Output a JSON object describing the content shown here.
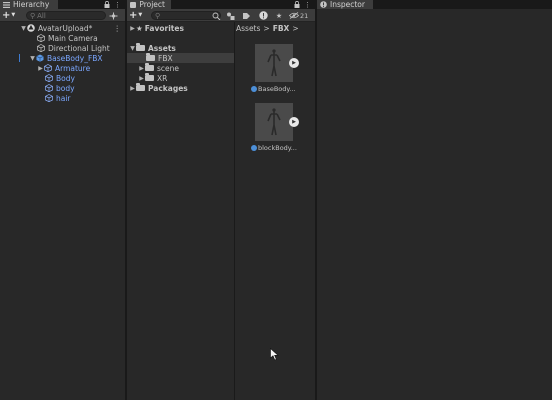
{
  "hierarchy": {
    "tab_label": "Hierarchy",
    "search_placeholder": "All",
    "scene_name": "AvatarUpload*",
    "items": [
      {
        "label": "Main Camera"
      },
      {
        "label": "Directional Light"
      },
      {
        "label": "BaseBody_FBX"
      },
      {
        "label": "Armature"
      },
      {
        "label": "Body"
      },
      {
        "label": "body"
      },
      {
        "label": "hair"
      }
    ]
  },
  "project": {
    "tab_label": "Project",
    "hidden_count": "21",
    "tree": {
      "favorites": "Favorites",
      "assets": "Assets",
      "fbx": "FBX",
      "scene": "scene",
      "xr": "XR",
      "packages": "Packages"
    },
    "breadcrumb": {
      "root": "Assets",
      "sep": ">",
      "current": "FBX",
      "end": ">"
    },
    "assets": [
      {
        "label": "BaseBody..."
      },
      {
        "label": "blockBody..."
      }
    ]
  },
  "inspector": {
    "tab_label": "Inspector"
  },
  "colors": {
    "selection": "#2c5d87",
    "folder_selected": "#3e3e3e",
    "accent_blue": "#7ba7ff"
  }
}
